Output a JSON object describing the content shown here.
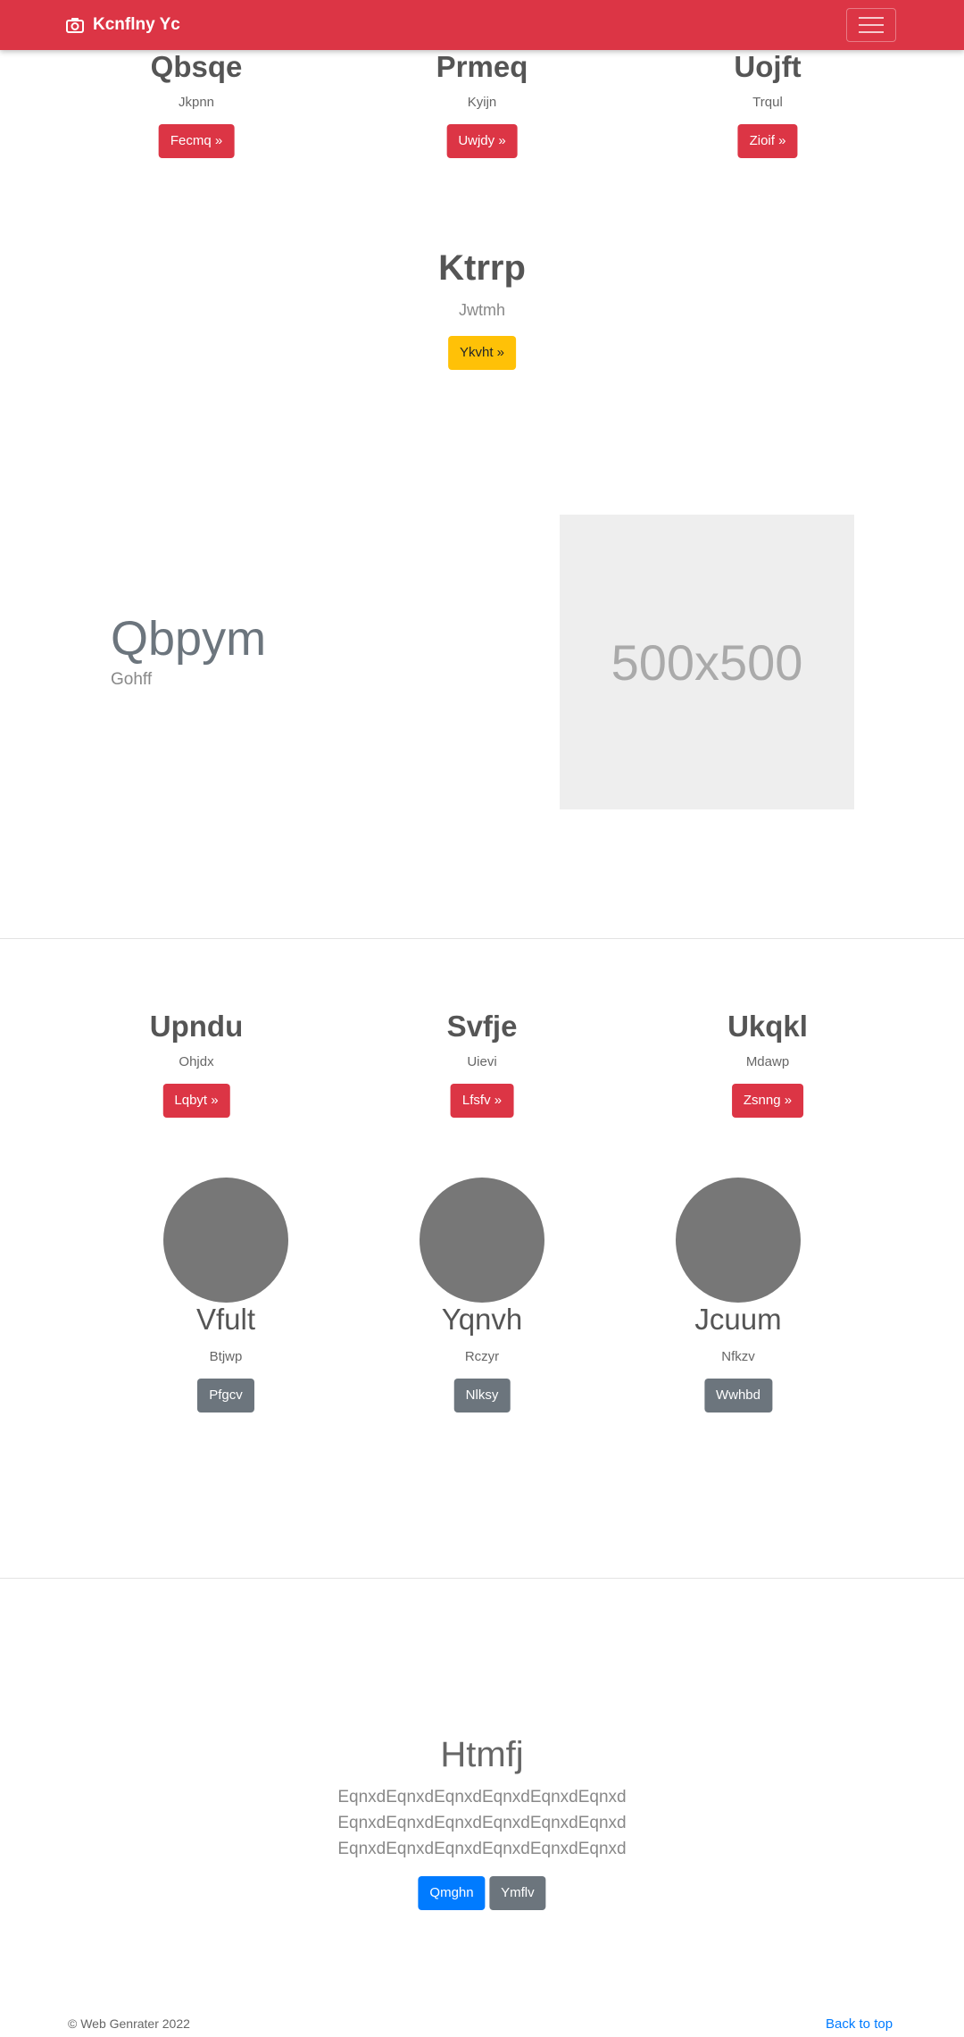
{
  "navbar": {
    "brand": "Kcnflny Yc",
    "brand_icon": "camera-icon",
    "toggler_icon": "hamburger-icon",
    "color": "#dc3545"
  },
  "top_columns": [
    {
      "title": "Qbsqe",
      "subtitle": "Jkpnn",
      "button": "Fecmq »"
    },
    {
      "title": "Prmeq",
      "subtitle": "Kyijn",
      "button": "Uwjdy »"
    },
    {
      "title": "Uojft",
      "subtitle": "Trqul",
      "button": "Zioif »"
    }
  ],
  "center_block": {
    "title": "Ktrrp",
    "subtitle": "Jwtmh",
    "button": "Ykvht »",
    "button_color": "#ffc107"
  },
  "feature": {
    "title": "Qbpym",
    "subtitle": "Gohff",
    "image_label": "500x500"
  },
  "middle_columns": [
    {
      "title": "Upndu",
      "subtitle": "Ohjdx",
      "button": "Lqbyt »"
    },
    {
      "title": "Svfje",
      "subtitle": "Uievi",
      "button": "Lfsfv »"
    },
    {
      "title": "Ukqkl",
      "subtitle": "Mdawp",
      "button": "Zsnng »"
    }
  ],
  "circle_columns": [
    {
      "title": "Vfult",
      "subtitle": "Btjwp",
      "button": "Pfgcv"
    },
    {
      "title": "Yqnvh",
      "subtitle": "Rczyr",
      "button": "Nlksy"
    },
    {
      "title": "Jcuum",
      "subtitle": "Nfkzv",
      "button": "Wwhbd"
    }
  ],
  "hero": {
    "title": "Htmfj",
    "lines": [
      "EqnxdEqnxdEqnxdEqnxdEqnxdEqnxd",
      "EqnxdEqnxdEqnxdEqnxdEqnxdEqnxd",
      "EqnxdEqnxdEqnxdEqnxdEqnxdEqnxd"
    ],
    "primary_button": "Qmghn",
    "secondary_button": "Ymflv"
  },
  "footer": {
    "copyright": "© Web Genrater 2022",
    "back_to_top": "Back to top"
  }
}
